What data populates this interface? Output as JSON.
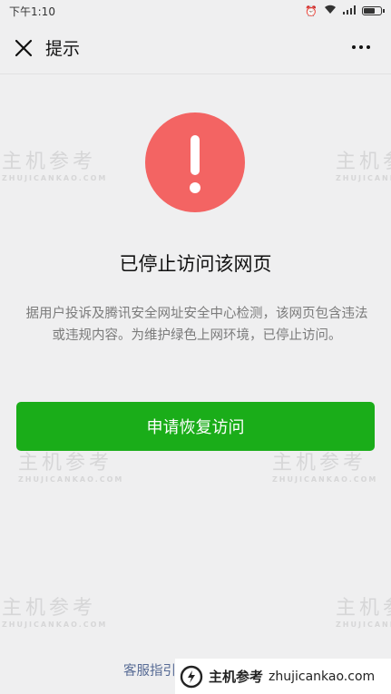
{
  "status_bar": {
    "time": "下午1:10"
  },
  "nav": {
    "title": "提示"
  },
  "notice": {
    "title": "已停止访问该网页",
    "description": "据用户投诉及腾讯安全网址安全中心检测，该网页包含违法或违规内容。为维护绿色上网环境，已停止访问。"
  },
  "actions": {
    "appeal_label": "申请恢复访问"
  },
  "footer": {
    "guide_label": "客服指引"
  },
  "watermark": {
    "brand": "主机参考",
    "url": "zhujicankao.com",
    "small": "ZHUJICANKAO.COM"
  },
  "colors": {
    "warning": "#f36463",
    "primary": "#1aad19",
    "link": "#576b95"
  }
}
